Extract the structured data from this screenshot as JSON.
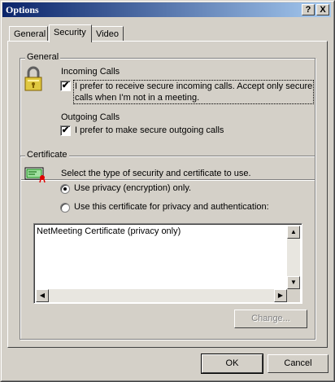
{
  "window": {
    "title": "Options",
    "help_btn": "?",
    "close_btn": "X"
  },
  "tabs": [
    "General",
    "Security",
    "Video"
  ],
  "general_group": {
    "label": "General",
    "incoming_label": "Incoming Calls",
    "incoming_checkbox_line1": "I prefer to receive secure incoming calls. Accept only secure",
    "incoming_checkbox_line2": "calls when I'm not in a meeting.",
    "outgoing_label": "Outgoing Calls",
    "outgoing_checkbox": "I prefer to make secure outgoing calls"
  },
  "certificate_group": {
    "label": "Certificate",
    "instructions": "Select the type of security and certificate to use.",
    "radio_privacy": "Use privacy (encryption) only.",
    "radio_cert": "Use this certificate for privacy and authentication:",
    "list_items": [
      "NetMeeting Certificate (privacy only)"
    ],
    "change_button": "Change..."
  },
  "buttons": {
    "ok": "OK",
    "cancel": "Cancel"
  }
}
